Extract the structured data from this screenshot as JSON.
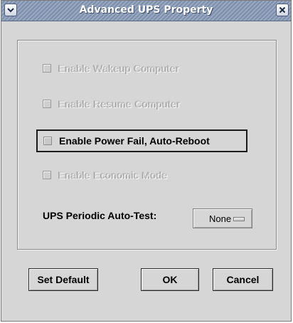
{
  "window": {
    "title": "Advanced UPS Property"
  },
  "options": [
    {
      "label": "Enable Wakeup Computer",
      "enabled": false,
      "checked": false
    },
    {
      "label": "Enable Resume Computer",
      "enabled": false,
      "checked": false
    },
    {
      "label": "Enable Power Fail, Auto-Reboot",
      "enabled": true,
      "checked": false,
      "focused": true
    },
    {
      "label": "Enable Economic Mode",
      "enabled": false,
      "checked": false
    }
  ],
  "periodic_test": {
    "label": "UPS Periodic Auto-Test:",
    "selected": "None"
  },
  "buttons": {
    "set_default": "Set Default",
    "ok": "OK",
    "cancel": "Cancel"
  },
  "colors": {
    "titlebar": "#8a9bb5",
    "dialog_bg": "#d6d6d6",
    "disabled_text": "#c4c4c4"
  },
  "icons": {
    "menu": "chevron-down-icon",
    "close": "close-icon"
  }
}
